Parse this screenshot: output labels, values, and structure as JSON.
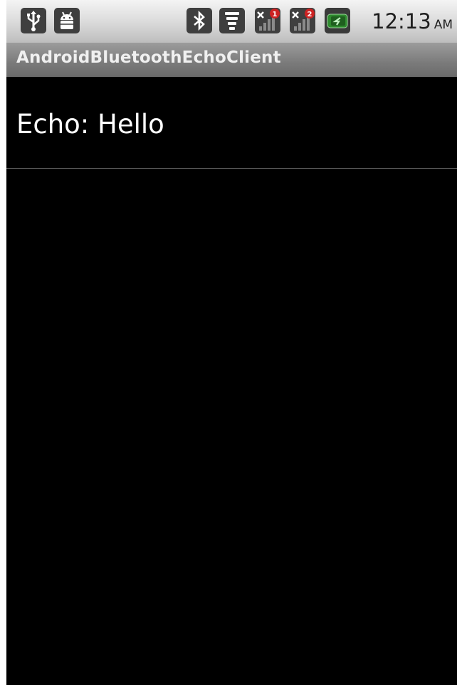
{
  "status_bar": {
    "time": "12:13",
    "ampm": "AM",
    "icons": [
      "usb-icon",
      "android-debug-icon",
      "bluetooth-icon",
      "wifi-icon",
      "signal-1-icon",
      "signal-2-icon",
      "battery-charging-icon"
    ],
    "badges": {
      "signal_1": "1",
      "signal_2": "2"
    },
    "colors": {
      "battery": "#2e8b2e",
      "badge": "#cc2222"
    }
  },
  "title_bar": {
    "title": "AndroidBluetoothEchoClient"
  },
  "list": {
    "items": [
      {
        "label": "Echo: Hello"
      }
    ]
  }
}
